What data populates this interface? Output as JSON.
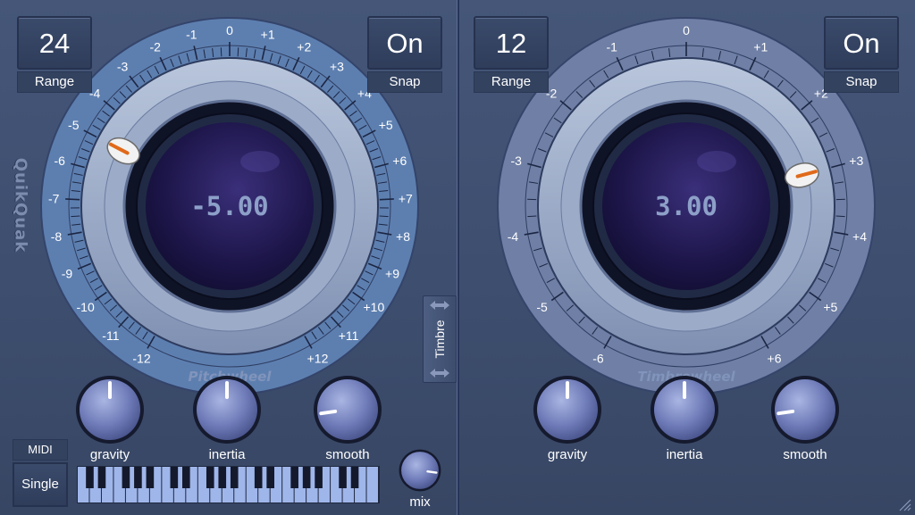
{
  "brand": {
    "logo_text": "QuikQuak"
  },
  "pitch": {
    "range": {
      "value": "24",
      "label": "Range"
    },
    "snap": {
      "value": "On",
      "label": "Snap"
    },
    "display": "-5.00",
    "position": -5,
    "wheel_label": "Pitchwheel",
    "scale_min": -12,
    "scale_max": 12,
    "scale_labels": [
      "-12",
      "-11",
      "-10",
      "-9",
      "-8",
      "-7",
      "-6",
      "-5",
      "-4",
      "-3",
      "-2",
      "-1",
      "0",
      "+1",
      "+2",
      "+3",
      "+4",
      "+5",
      "+6",
      "+7",
      "+8",
      "+9",
      "+10",
      "+11",
      "+12"
    ],
    "knobs": [
      {
        "label": "gravity",
        "value": 0.5
      },
      {
        "label": "inertia",
        "value": 0.5
      },
      {
        "label": "smooth",
        "value": 0.15
      }
    ],
    "midi": {
      "header": "MIDI",
      "mode": "Single"
    },
    "mix": {
      "label": "mix",
      "value": 0.85
    }
  },
  "timbre_toggle": {
    "label": "Timbre"
  },
  "timbre": {
    "range": {
      "value": "12",
      "label": "Range"
    },
    "snap": {
      "value": "On",
      "label": "Snap"
    },
    "display": "3.00",
    "position": 3,
    "wheel_label": "Timbrewheel",
    "scale_min": -6,
    "scale_max": 6,
    "scale_labels": [
      "-6",
      "-5",
      "-4",
      "-3",
      "-2",
      "-1",
      "0",
      "+1",
      "+2",
      "+3",
      "+4",
      "+5",
      "+6"
    ],
    "knobs": [
      {
        "label": "gravity",
        "value": 0.5
      },
      {
        "label": "inertia",
        "value": 0.5
      },
      {
        "label": "smooth",
        "value": 0.15
      }
    ]
  },
  "colors": {
    "pitch_ring": "#5d7fb0",
    "timbre_ring": "#6f7fa5",
    "display_text": "#8da0c8",
    "pointer": "#e06a1a"
  }
}
